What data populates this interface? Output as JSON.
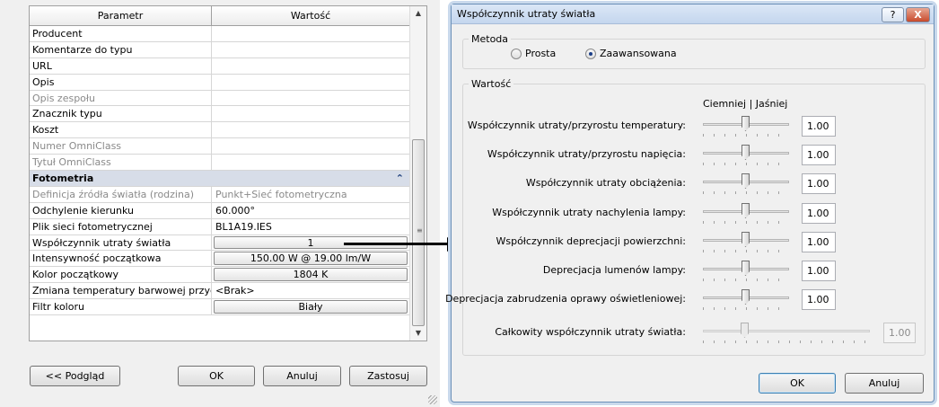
{
  "properties_panel": {
    "header": {
      "parameter": "Parametr",
      "value": "Wartość"
    },
    "rows": [
      {
        "key": "Producent",
        "value": "",
        "dim": false
      },
      {
        "key": "Komentarze do typu",
        "value": "",
        "dim": false
      },
      {
        "key": "URL",
        "value": "",
        "dim": false
      },
      {
        "key": "Opis",
        "value": "",
        "dim": false
      },
      {
        "key": "Opis zespołu",
        "value": "",
        "dim": true
      },
      {
        "key": "Znacznik typu",
        "value": "",
        "dim": false
      },
      {
        "key": "Koszt",
        "value": "",
        "dim": false
      },
      {
        "key": "Numer OmniClass",
        "value": "",
        "dim": true
      },
      {
        "key": "Tytuł OmniClass",
        "value": "",
        "dim": true
      }
    ],
    "section": {
      "title": "Fotometria",
      "collapse_glyph": "«"
    },
    "photometry_rows": [
      {
        "key": "Definicja źródła światła (rodzina)",
        "value": "Punkt+Sieć fotometryczna"
      },
      {
        "key": "Odchylenie kierunku",
        "value": "60.000°"
      },
      {
        "key": "Plik sieci fotometrycznej",
        "value": "BL1A19.IES"
      },
      {
        "key": "Współczynnik utraty światła",
        "value": "1"
      },
      {
        "key": "Intensywność początkowa",
        "value": "150.00 W @ 19.00 lm/W"
      },
      {
        "key": "Kolor początkowy",
        "value": "1804 K"
      },
      {
        "key": "Zmiana temperatury barwowej przyci",
        "value": "<Brak>"
      },
      {
        "key": "Filtr koloru",
        "value": "Biały"
      }
    ],
    "buttons": {
      "preview": "<< Podgląd",
      "ok": "OK",
      "cancel": "Anuluj",
      "apply": "Zastosuj"
    }
  },
  "dialog": {
    "title": "Współczynnik utraty światła",
    "help_label": "?",
    "close_label": "X",
    "method": {
      "label": "Metoda",
      "options": [
        "Prosta",
        "Zaawansowana"
      ],
      "selected": "Zaawansowana"
    },
    "value_group": {
      "label": "Wartość",
      "scale_header": "Ciemniej  |  Jaśniej",
      "factors": [
        {
          "label": "Współczynnik utraty/przyrostu temperatury:",
          "value": "1.00",
          "level": 0.5
        },
        {
          "label": "Współczynnik utraty/przyrostu napięcia:",
          "value": "1.00",
          "level": 0.5
        },
        {
          "label": "Współczynnik utraty obciążenia:",
          "value": "1.00",
          "level": 0.5
        },
        {
          "label": "Współczynnik utraty nachylenia lampy:",
          "value": "1.00",
          "level": 0.5
        },
        {
          "label": "Współczynnik deprecjacji powierzchni:",
          "value": "1.00",
          "level": 0.5
        },
        {
          "label": "Deprecjacja lumenów lampy:",
          "value": "1.00",
          "level": 0.5
        },
        {
          "label": "Deprecjacja zabrudzenia oprawy oświetleniowej:",
          "value": "1.00",
          "level": 0.5
        }
      ],
      "total": {
        "label": "Całkowity współczynnik utraty światła:",
        "value": "1.00",
        "level": 0.25
      }
    },
    "buttons": {
      "ok": "OK",
      "cancel": "Anuluj"
    }
  }
}
